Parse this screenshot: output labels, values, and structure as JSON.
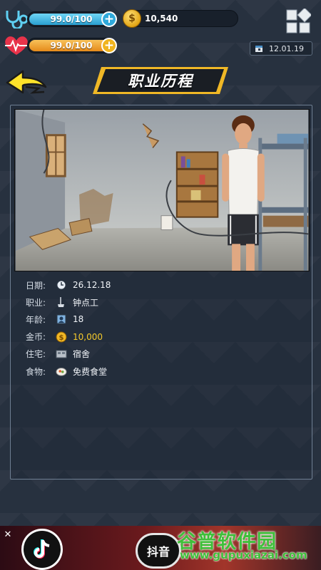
{
  "status": {
    "health_text": "99.0/100",
    "health_fill_fraction": 0.99,
    "energy_text": "99.0/100",
    "energy_fill_fraction": 0.99,
    "coins": "10,540",
    "date": "12.01.19"
  },
  "header": {
    "title": "职业历程"
  },
  "career_record": {
    "date_label": "日期:",
    "date_value": "26.12.18",
    "job_label": "职业:",
    "job_value": "钟点工",
    "age_label": "年龄:",
    "age_value": "18",
    "money_label": "金币:",
    "money_value": "10,000",
    "home_label": "住宅:",
    "home_value": "宿舍",
    "food_label": "食物:",
    "food_value": "免费食堂"
  },
  "ad": {
    "close": "✕",
    "pill_text": "抖音"
  },
  "watermark": {
    "cn": "谷普软件园",
    "url": "www.gupuxiazai.com"
  },
  "colors": {
    "health_fill": "#3fb8e6",
    "energy_fill": "#f0a12a",
    "gold_text": "#f4c92b"
  }
}
